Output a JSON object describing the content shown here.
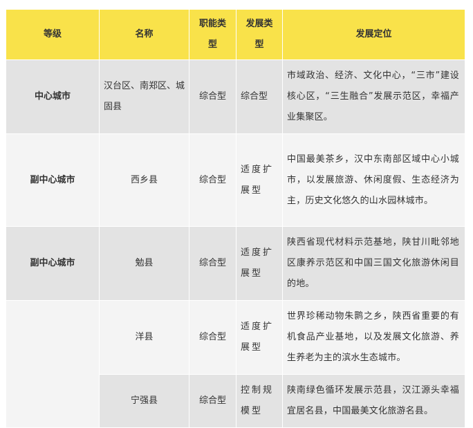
{
  "table": {
    "headers": {
      "grade": "等级",
      "name": "名称",
      "function_type": "职能类型",
      "dev_type": "发展类型",
      "positioning": "发展定位"
    },
    "rows": [
      {
        "grade": "中心城市",
        "name": "汉台区、南郑区、城固县",
        "function_type": "综合型",
        "dev_type": "综合型",
        "positioning": "市域政治、经济、文化中心，“三市”建设核心区，“三生融合”发展示范区，幸福产业集聚区。"
      },
      {
        "grade": "副中心城市",
        "name": "西乡县",
        "function_type": "综合型",
        "dev_type": "适度扩展型",
        "positioning": "中国最美茶乡，汉中东南部区域中心小城市，以发展旅游、休闲度假、生态经济为主，历史文化悠久的山水园林城市。"
      },
      {
        "grade": "副中心城市",
        "name": "勉县",
        "function_type": "综合型",
        "dev_type": "适度扩展型",
        "positioning": "陕西省现代材料示范基地，陕甘川毗邻地区康养示范区和中国三国文化旅游休闲目的地。"
      },
      {
        "grade": "",
        "name": "洋县",
        "function_type": "综合型",
        "dev_type": "适度扩展型",
        "positioning": "世界珍稀动物朱鹮之乡，陕西省重要的有机食品产业基地，以及发展文化旅游、养生养老为主的滨水生态城市。"
      },
      {
        "grade": "",
        "name": "宁强县",
        "function_type": "综合型",
        "dev_type": "控制规模型",
        "positioning": "陕南绿色循环发展示范县，汉江源头幸福宜居名县，中国最美文化旅游名县。"
      }
    ]
  },
  "colors": {
    "header_bg": "#f9e24a",
    "row_dark": "#e3e3e3",
    "row_light": "#f4f4f4"
  }
}
